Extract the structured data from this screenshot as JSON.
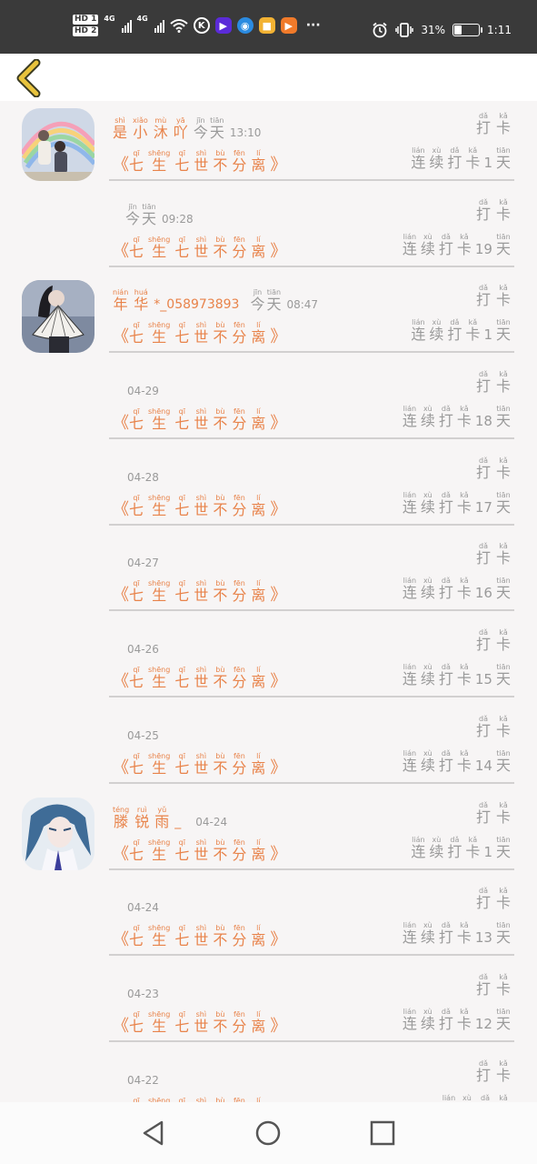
{
  "status_bar": {
    "hd1": "HD 1",
    "hd2": "HD 2",
    "net1": "4G",
    "net2": "4G",
    "apps": [
      "wifi-icon",
      "k-app-icon",
      "video-app-icon",
      "globe-app-icon",
      "yellow-app-icon",
      "orange-app-icon"
    ],
    "more": "···",
    "battery_text": "31%",
    "battery_level": 0.31,
    "time": "1:11"
  },
  "colors": {
    "accent": "#e8834a",
    "muted": "#9a9a9a",
    "divider": "#d2d0d0",
    "back": "#e8c33c"
  },
  "title_words": [
    {
      "py": "qī",
      "hz": "七"
    },
    {
      "py": "shēng",
      "hz": "生"
    },
    {
      "py": "qī",
      "hz": "七"
    },
    {
      "py": "shì",
      "hz": "世"
    },
    {
      "py": "bù",
      "hz": "不"
    },
    {
      "py": "fēn",
      "hz": "分"
    },
    {
      "py": "lí",
      "hz": "离"
    }
  ],
  "bracket_open": "《",
  "bracket_close": "》",
  "checkin": [
    {
      "py": "dǎ",
      "hz": "打"
    },
    {
      "py": "kǎ",
      "hz": "卡"
    }
  ],
  "streak_pre": [
    {
      "py": "lián",
      "hz": "连"
    },
    {
      "py": "xù",
      "hz": "续"
    },
    {
      "py": "dǎ",
      "hz": "打"
    },
    {
      "py": "kǎ",
      "hz": "卡"
    }
  ],
  "streak_post": {
    "py": "tiān",
    "hz": "天"
  },
  "today": [
    {
      "py": "jīn",
      "hz": "今"
    },
    {
      "py": "tiān",
      "hz": "天"
    }
  ],
  "entries": [
    {
      "user": {
        "name_ruby": [
          {
            "py": "shì",
            "hz": "是"
          },
          {
            "py": "xiǎo",
            "hz": "小"
          },
          {
            "py": "mù",
            "hz": "沐"
          },
          {
            "py": "yā",
            "hz": "吖"
          }
        ],
        "name_extra": "",
        "avatar": "avatar-rainbow-couple"
      },
      "today": true,
      "time": "13:10",
      "days": "1"
    },
    {
      "user": null,
      "today": true,
      "time": "09:28",
      "days": "19"
    },
    {
      "user": {
        "name_ruby": [
          {
            "py": "nián",
            "hz": "年"
          },
          {
            "py": "huá",
            "hz": "华"
          }
        ],
        "name_extra": "*_058973893",
        "avatar": "avatar-girl-fan"
      },
      "today": true,
      "time": "08:47",
      "days": "1"
    },
    {
      "user": null,
      "today": false,
      "time": "04-29",
      "days": "18"
    },
    {
      "user": null,
      "today": false,
      "time": "04-28",
      "days": "17"
    },
    {
      "user": null,
      "today": false,
      "time": "04-27",
      "days": "16"
    },
    {
      "user": null,
      "today": false,
      "time": "04-26",
      "days": "15"
    },
    {
      "user": null,
      "today": false,
      "time": "04-25",
      "days": "14"
    },
    {
      "user": {
        "name_ruby": [
          {
            "py": "téng",
            "hz": "滕"
          },
          {
            "py": "ruì",
            "hz": "锐"
          },
          {
            "py": "yǔ",
            "hz": "雨"
          }
        ],
        "name_extra": "_",
        "avatar": "avatar-anime-boy"
      },
      "today": false,
      "time": "04-24",
      "days": "1"
    },
    {
      "user": null,
      "today": false,
      "time": "04-24",
      "days": "13"
    },
    {
      "user": null,
      "today": false,
      "time": "04-23",
      "days": "12"
    },
    {
      "user": null,
      "today": false,
      "time": "04-22",
      "days": ""
    }
  ],
  "nav": [
    "back-triangle-icon",
    "home-circle-icon",
    "recents-square-icon"
  ]
}
